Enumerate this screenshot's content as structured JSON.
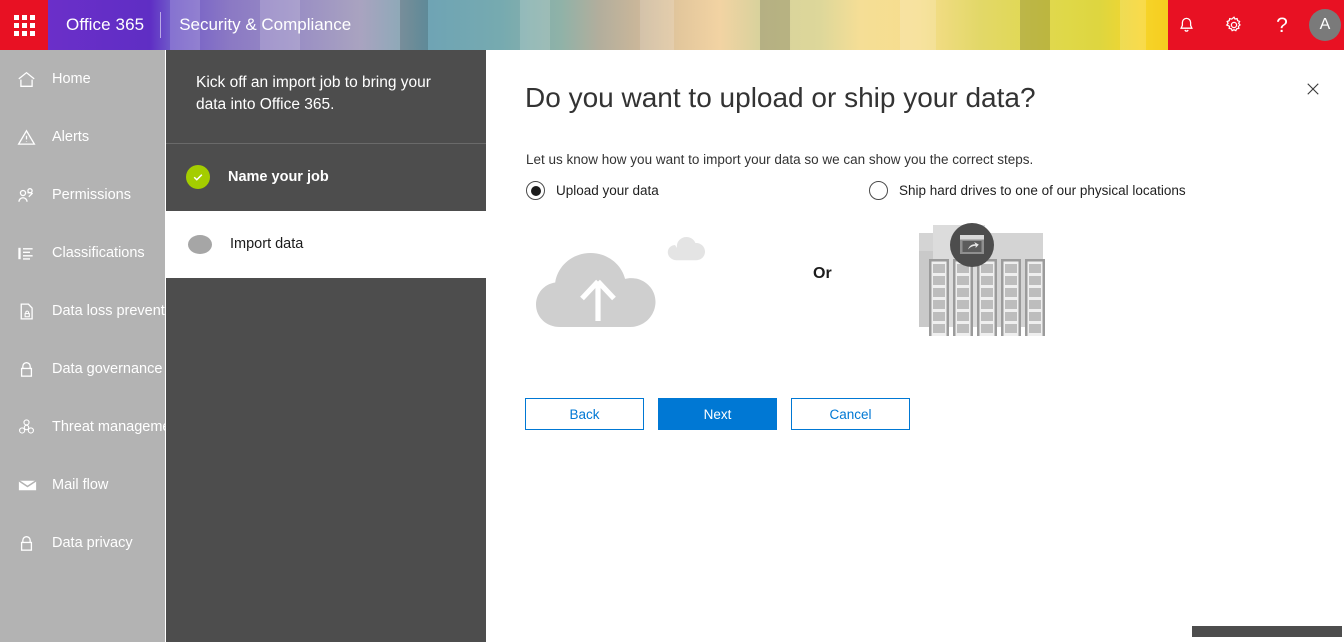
{
  "suitebar": {
    "waffle_label": "app-launcher",
    "brand": "Office 365",
    "app_name": "Security & Compliance",
    "notifications_icon": "bell-icon",
    "settings_icon": "gear-icon",
    "help_label": "?",
    "avatar_initial": "A",
    "accent_red": "#e81123",
    "accent_purple": "#5f2ec4",
    "accent_yellow": "#f5cd1f"
  },
  "leftnav": {
    "background": "#b3b3b3",
    "items": [
      {
        "label": "Home",
        "icon": "home-icon"
      },
      {
        "label": "Alerts",
        "icon": "alert-triangle-icon"
      },
      {
        "label": "Permissions",
        "icon": "people-icon"
      },
      {
        "label": "Classifications",
        "icon": "list-icon"
      },
      {
        "label": "Data loss preventi",
        "icon": "document-lock-icon"
      },
      {
        "label": "Data governance",
        "icon": "lock-icon"
      },
      {
        "label": "Threat manageme",
        "icon": "biohazard-icon"
      },
      {
        "label": "Mail flow",
        "icon": "envelope-icon"
      },
      {
        "label": "Data privacy",
        "icon": "lock-icon"
      }
    ]
  },
  "wizard": {
    "background": "#4d4d4d",
    "intro": "Kick off an import job to bring your data into Office 365.",
    "steps": [
      {
        "label": "Name your job",
        "state": "completed",
        "bullet": "check-circle-icon"
      },
      {
        "label": "Import data",
        "state": "active",
        "bullet": "dot-icon"
      }
    ]
  },
  "content": {
    "close_icon": "close-icon",
    "title": "Do you want to upload or ship your data?",
    "subtitle": "Let us know how you want to import your data so we can show you the correct steps.",
    "options": [
      {
        "label": "Upload your data",
        "selected": true
      },
      {
        "label": "Ship hard drives to one of our physical locations",
        "selected": false
      }
    ],
    "or_label": "Or",
    "illustration_left": "cloud-upload-illustration",
    "illustration_right": "datacenter-servers-illustration",
    "buttons": {
      "back": "Back",
      "next": "Next",
      "cancel": "Cancel"
    },
    "primary_color": "#0078d4"
  }
}
